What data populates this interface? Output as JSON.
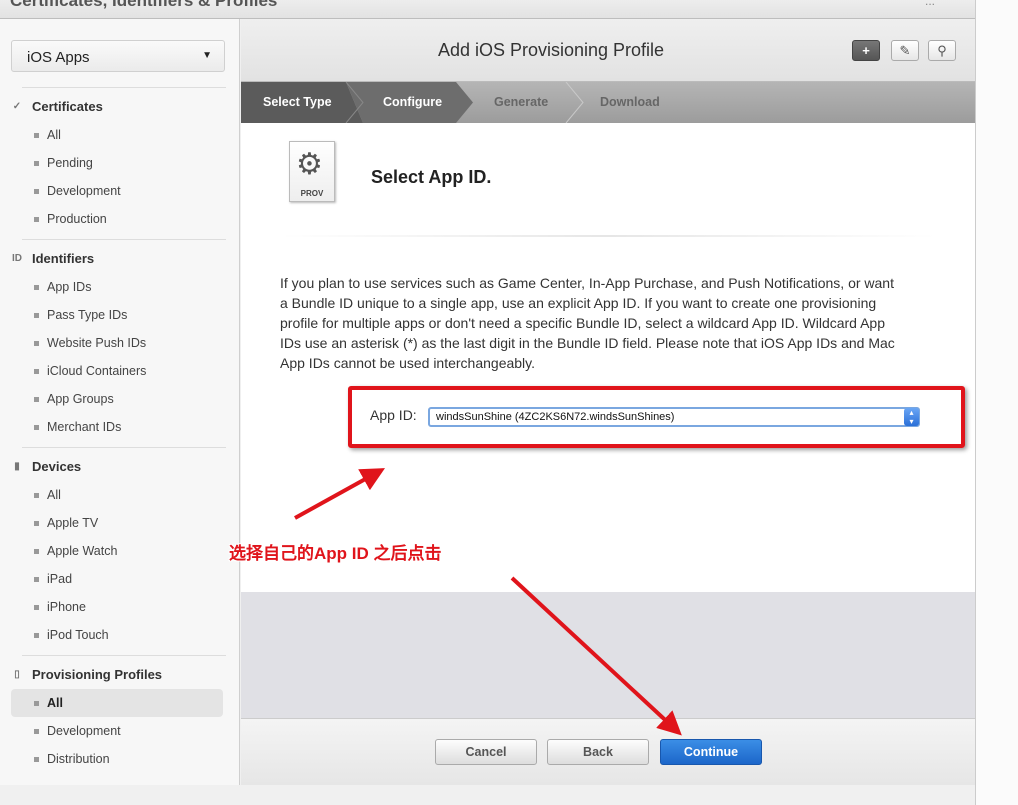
{
  "app_title": "Certificates, Identifiers & Profiles",
  "top_right": "...",
  "sidebar": {
    "platform_select": "iOS Apps",
    "sections": [
      {
        "title": "Certificates",
        "icon": "certificate-icon",
        "items": [
          "All",
          "Pending",
          "Development",
          "Production"
        ]
      },
      {
        "title": "Identifiers",
        "icon": "id-icon",
        "items": [
          "App IDs",
          "Pass Type IDs",
          "Website Push IDs",
          "iCloud Containers",
          "App Groups",
          "Merchant IDs"
        ]
      },
      {
        "title": "Devices",
        "icon": "device-icon",
        "items": [
          "All",
          "Apple TV",
          "Apple Watch",
          "iPad",
          "iPhone",
          "iPod Touch"
        ]
      },
      {
        "title": "Provisioning Profiles",
        "icon": "document-icon",
        "items": [
          "All",
          "Development",
          "Distribution"
        ],
        "selected": "All"
      }
    ]
  },
  "header": {
    "title": "Add iOS Provisioning Profile",
    "buttons": [
      "plus-icon",
      "edit-icon",
      "search-icon"
    ]
  },
  "steps": [
    {
      "label": "Select Type",
      "state": "done"
    },
    {
      "label": "Configure",
      "state": "active"
    },
    {
      "label": "Generate",
      "state": "pending"
    },
    {
      "label": "Download",
      "state": "pending"
    }
  ],
  "content": {
    "icon_label": "PROV",
    "heading": "Select App ID.",
    "description": "If you plan to use services such as Game Center, In-App Purchase, and Push Notifications, or want a Bundle ID unique to a single app, use an explicit App ID. If you want to create one provisioning profile for multiple apps or don't need a specific Bundle ID, select a wildcard App ID. Wildcard App IDs use an asterisk (*) as the last digit in the Bundle ID field. Please note that iOS App IDs and Mac App IDs cannot be used interchangeably.",
    "app_id_label": "App ID:",
    "app_id_value": "windsSunShine (4ZC2KS6N72.windsSunShines)",
    "annotation": "选择自己的App ID 之后点击"
  },
  "footer": {
    "cancel": "Cancel",
    "back": "Back",
    "continue": "Continue"
  },
  "colors": {
    "annotation": "#e0141b",
    "primary": "#1c66c9"
  }
}
